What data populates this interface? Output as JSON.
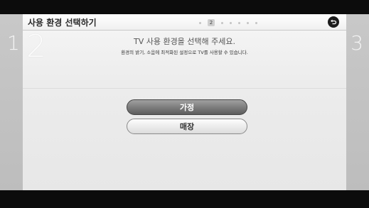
{
  "header": {
    "title": "사용 환경 선택하기",
    "step_indicator": {
      "current": "2",
      "total_dots": 7,
      "current_index": 1
    }
  },
  "steps": {
    "previous": "1",
    "current": "2",
    "next": "3"
  },
  "content": {
    "heading": "TV 사용 환경을 선택해 주세요.",
    "subheading": "환경의 밝기, 소음에 최적화된 설정으로 TV를 사용할 수 있습니다."
  },
  "options": [
    {
      "label": "가정",
      "selected": true
    },
    {
      "label": "매장",
      "selected": false
    }
  ],
  "icons": {
    "back": "return-arrow-icon"
  },
  "colors": {
    "selected_button": "#5c5c5c",
    "background": "#e9e9e9"
  }
}
